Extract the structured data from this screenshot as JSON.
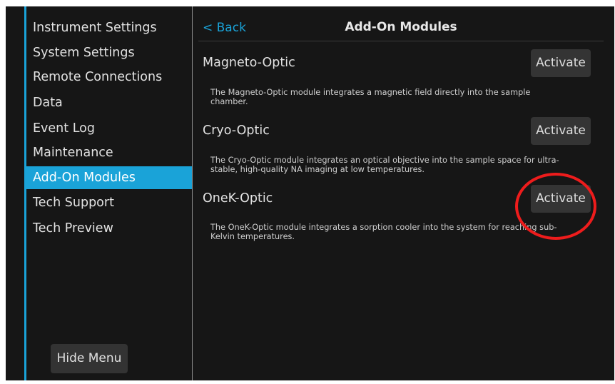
{
  "sidebar": {
    "items": [
      {
        "label": "Instrument Settings",
        "active": false
      },
      {
        "label": "System Settings",
        "active": false
      },
      {
        "label": "Remote Connections",
        "active": false
      },
      {
        "label": "Data",
        "active": false
      },
      {
        "label": "Event Log",
        "active": false
      },
      {
        "label": "Maintenance",
        "active": false
      },
      {
        "label": "Add-On Modules",
        "active": true
      },
      {
        "label": "Tech Support",
        "active": false
      },
      {
        "label": "Tech Preview",
        "active": false
      }
    ],
    "hide_menu_label": "Hide Menu"
  },
  "header": {
    "back_label": "< Back",
    "title": "Add-On Modules"
  },
  "modules": [
    {
      "name": "Magneto-Optic",
      "button_label": "Activate",
      "description": "The Magneto-Optic module integrates a magnetic field directly into the sample chamber."
    },
    {
      "name": "Cryo-Optic",
      "button_label": "Activate",
      "description": "The Cryo-Optic module integrates an optical objective into the sample space for ultra-stable, high-quality NA imaging at low temperatures."
    },
    {
      "name": "OneK-Optic",
      "button_label": "Activate",
      "description": "The OneK-Optic module integrates a sorption cooler into the system for reaching sub-Kelvin temperatures."
    }
  ],
  "colors": {
    "accent": "#1aa3d8",
    "background": "#161616",
    "button": "#343434",
    "annotation": "#ee1c1c"
  }
}
